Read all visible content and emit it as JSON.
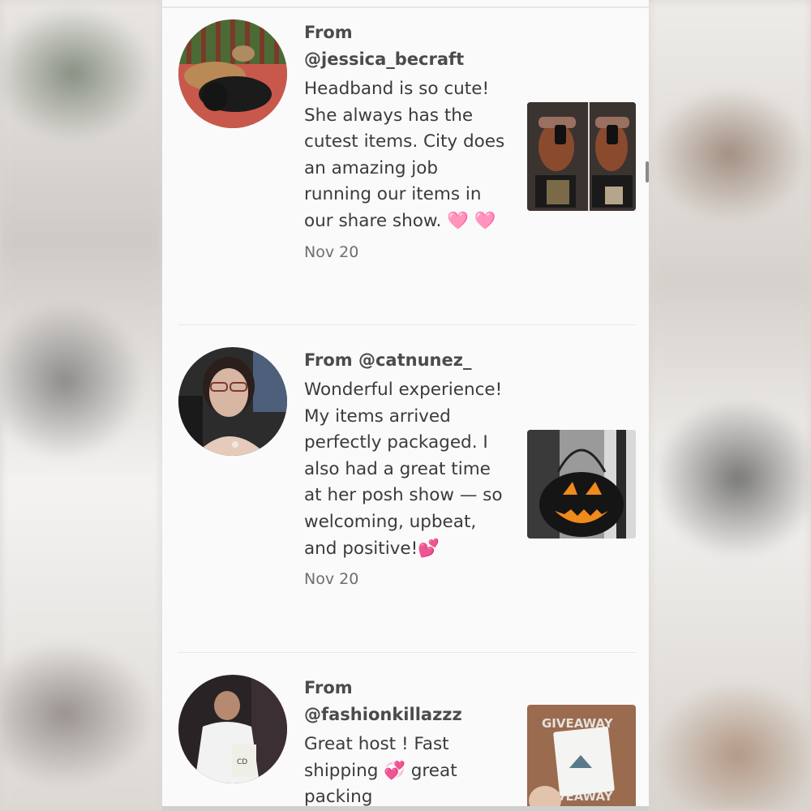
{
  "reviews": [
    {
      "from_label": "From",
      "username": "@jessica_becraft",
      "text": "Headband is so cute! She always has the cutest items. City does an amazing job running our items in our share show. 🩷 🩷",
      "date": "Nov 20",
      "avatar_icon": "dogs-on-deck-photo",
      "thumb_icon": "headband-mirror-selfie-photo"
    },
    {
      "from_label": "From",
      "username": "@catnunez_",
      "text": "Wonderful experience! My items arrived perfectly packaged. I also had a great time at her posh show — so welcoming, upbeat, and positive!💕",
      "date": "Nov 20",
      "avatar_icon": "woman-in-car-selfie-photo",
      "thumb_icon": "jack-o-lantern-bucket-photo"
    },
    {
      "from_label": "From",
      "username": "@fashionkillazzz",
      "text": "Great host ! Fast shipping 💞 great packing",
      "date": "",
      "avatar_icon": "mirror-selfie-photo",
      "thumb_icon": "giveaway-card-photo",
      "thumb_text": "GIVEAWAY"
    }
  ],
  "colors": {
    "text": "#3b3b3b",
    "date": "#6e6e6e",
    "divider": "#e7e7e7",
    "panel": "#fafafa"
  }
}
